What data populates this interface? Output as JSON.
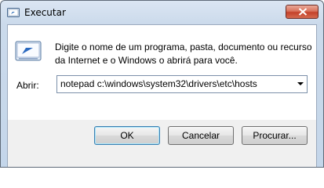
{
  "window": {
    "title": "Executar",
    "icon": "run-icon",
    "close_icon": "close-icon"
  },
  "dialog": {
    "description": "Digite o nome de um programa, pasta, documento ou recurso da Internet e o Windows o abrirá para você.",
    "open_label": "Abrir:",
    "open_value": "notepad c:\\windows\\system32\\drivers\\etc\\hosts"
  },
  "buttons": {
    "ok": "OK",
    "cancel": "Cancelar",
    "browse": "Procurar..."
  },
  "colors": {
    "accent": "#3c7fb1",
    "close": "#c4412a"
  }
}
